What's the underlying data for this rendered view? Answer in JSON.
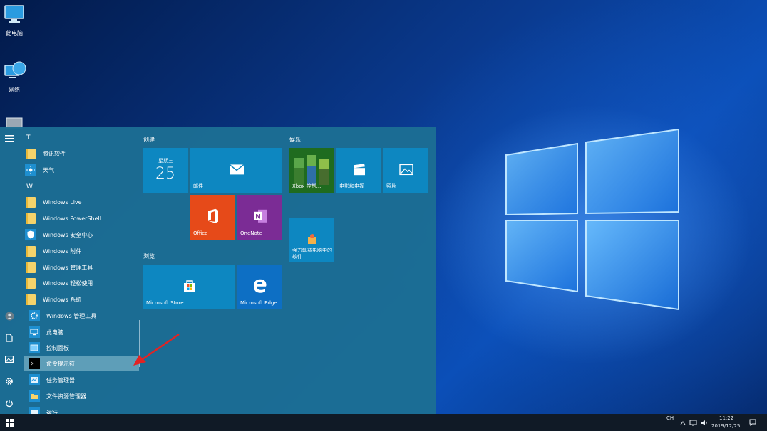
{
  "desktop": {
    "icons": [
      {
        "label": "此电脑",
        "icon": "this-pc-icon"
      },
      {
        "label": "网络",
        "icon": "network-icon"
      },
      {
        "label": "",
        "icon": "recycle-bin-icon"
      }
    ]
  },
  "start_menu": {
    "rail": [
      "hamburger-menu-icon",
      "user-icon",
      "document-icon",
      "pictures-icon",
      "settings-icon",
      "power-icon"
    ],
    "sections": {
      "t": "T",
      "w": "W"
    },
    "apps": {
      "tencent": "腾讯软件",
      "weather": "天气",
      "windows_live": "Windows Live",
      "powershell": "Windows PowerShell",
      "security": "Windows 安全中心",
      "accessories": "Windows 附件",
      "admin_tools": "Windows 管理工具",
      "ease_of_access": "Windows 轻松使用",
      "system": "Windows 系统",
      "sys_admin_tools": "Windows 管理工具",
      "this_pc": "此电脑",
      "control_panel": "控制面板",
      "cmd": "命令提示符",
      "task_manager": "任务管理器",
      "file_explorer": "文件资源管理器",
      "run": "运行"
    },
    "groups": {
      "create": "创建",
      "browse": "浏览",
      "entertainment": "娱乐"
    },
    "tiles": {
      "calendar_day": "星期三",
      "calendar_date": "25",
      "mail": "邮件",
      "office": "Office",
      "onenote": "OneNote",
      "store": "Microsoft Store",
      "edge": "Microsoft Edge",
      "xbox": "Xbox 控制...",
      "movies": "电影和电视",
      "photos": "照片",
      "uninstaller": "强力卸载电脑中的软件"
    }
  },
  "taskbar": {
    "ime": "CH",
    "time": "11:22",
    "date": "2019/12/25"
  },
  "colors": {
    "start_bg": "#1c6e94",
    "tile_blue": "#0d87c1",
    "office": "#e64a19",
    "onenote": "#7b2c95",
    "taskbar": "#101a26"
  }
}
